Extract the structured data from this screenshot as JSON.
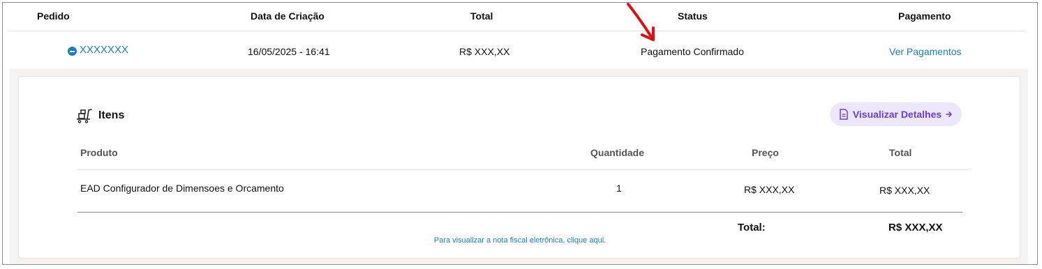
{
  "table": {
    "headers": {
      "pedido": "Pedido",
      "data": "Data de Criação",
      "total": "Total",
      "status": "Status",
      "pagamento": "Pagamento"
    },
    "row": {
      "order_id": "XXXXXXX",
      "date": "16/05/2025 - 16:41",
      "total": "R$ XXX,XX",
      "status": "Pagamento Confirmado",
      "payment_link": "Ver Pagamentos"
    }
  },
  "items_panel": {
    "title": "Itens",
    "details_button": "Visualizar Detalhes",
    "columns": {
      "produto": "Produto",
      "quantidade": "Quantidade",
      "preco": "Preço",
      "total": "Total"
    },
    "items": [
      {
        "produto": "EAD Configurador de Dimensoes e Orcamento",
        "quantidade": "1",
        "preco": "R$ XXX,XX",
        "total": "R$ XXX,XX"
      }
    ],
    "total_label": "Total:",
    "total_value": "R$ XXX,XX",
    "nfe_link": "Para visualizar a nota fiscal eletrônica, clique aqui."
  },
  "icons": {
    "collapse": "minus-circle-icon",
    "cart": "cart-icon",
    "document": "document-icon",
    "arrow_right": "arrow-right-icon",
    "annotation": "red-arrow-annotation-icon"
  },
  "colors": {
    "link": "#1a7fc1",
    "button_bg": "#ece7fb",
    "button_text": "#6b3fd6",
    "annotation": "#e01010",
    "panel_bg": "#f5f2ef"
  }
}
